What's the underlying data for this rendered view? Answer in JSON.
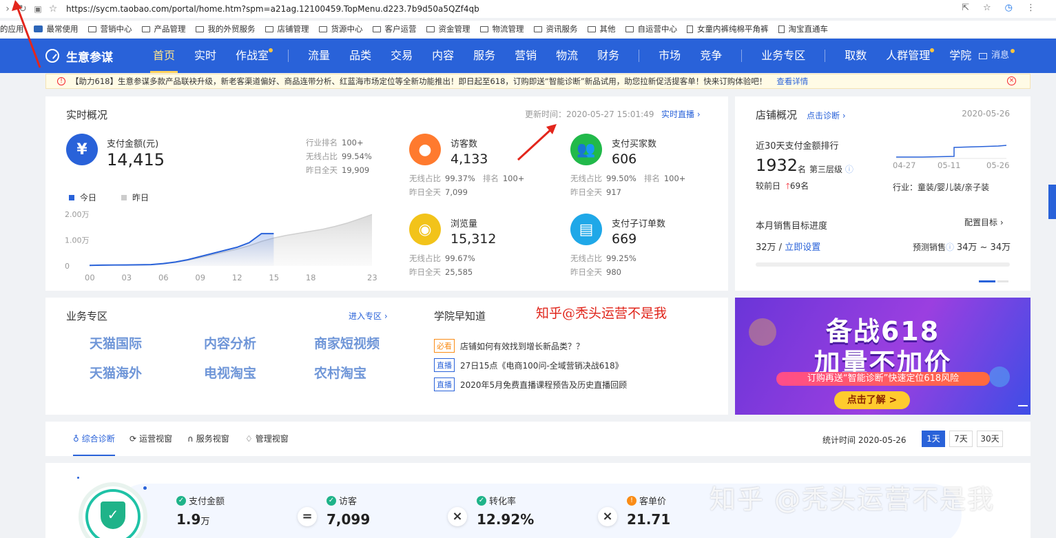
{
  "browser": {
    "url": "https://sycm.taobao.com/portal/home.htm?spm=a21ag.12100459.TopMenu.d223.7b9d50a5QZf4qb",
    "bookmarks": [
      "的应用",
      "最常使用",
      "营销中心",
      "产品管理",
      "我的外贸服务",
      "店铺管理",
      "货源中心",
      "客户运营",
      "资金管理",
      "物流管理",
      "资讯服务",
      "其他",
      "自运营中心",
      "女童内裤纯棉平角裤",
      "淘宝直通车"
    ]
  },
  "nav": {
    "brand": "生意参谋",
    "items": [
      "首页",
      "实时",
      "作战室",
      "流量",
      "品类",
      "交易",
      "内容",
      "服务",
      "营销",
      "物流",
      "财务",
      "市场",
      "竞争",
      "业务专区",
      "取数",
      "人群管理",
      "学院"
    ],
    "message": "消息"
  },
  "notice": {
    "text": "【助力618】生意参谋多款产品联袂升级，新老客渠道偏好、商品连带分析、红蓝海市场定位等全新功能推出！即日起至618，订购即送“智能诊断”新品试用，助您拉新促活提客单！快来订购体验吧！",
    "link": "查看详情"
  },
  "realtime": {
    "title": "实时概况",
    "update_time": "更新时间：2020-05-27 15:01:49",
    "live_link": "实时直播",
    "pay_amount": {
      "label": "支付金额(元)",
      "value": "14,415",
      "rank_label": "行业排名",
      "rank": "100+",
      "wireless_label": "无线占比",
      "wireless": "99.54%",
      "yday_label": "昨日全天",
      "yday": "19,909"
    },
    "visitors": {
      "label": "访客数",
      "value": "4,133",
      "wireless_label": "无线占比",
      "wireless": "99.37%",
      "rank_label": "排名",
      "rank": "100+",
      "yday_label": "昨日全天",
      "yday": "7,099"
    },
    "buyers": {
      "label": "支付买家数",
      "value": "606",
      "wireless_label": "无线占比",
      "wireless": "99.50%",
      "rank_label": "排名",
      "rank": "100+",
      "yday_label": "昨日全天",
      "yday": "917"
    },
    "pageviews": {
      "label": "浏览量",
      "value": "15,312",
      "wireless_label": "无线占比",
      "wireless": "99.67%",
      "yday_label": "昨日全天",
      "yday": "25,585"
    },
    "sub_orders": {
      "label": "支付子订单数",
      "value": "669",
      "wireless_label": "无线占比",
      "wireless": "99.25%",
      "yday_label": "昨日全天",
      "yday": "980"
    },
    "legend_today": "今日",
    "legend_yday": "昨日",
    "y_labels": [
      "2.00万",
      "1.00万",
      "0"
    ],
    "x_labels": [
      "00",
      "03",
      "06",
      "09",
      "12",
      "15",
      "18",
      "23"
    ]
  },
  "chart_data": {
    "type": "area",
    "x": [
      0,
      1,
      2,
      3,
      4,
      5,
      6,
      7,
      8,
      9,
      10,
      11,
      12,
      13,
      14,
      15,
      16,
      17,
      18,
      19,
      20,
      21,
      22,
      23
    ],
    "series": [
      {
        "name": "今日",
        "values": [
          200,
          300,
          350,
          380,
          420,
          500,
          900,
          1500,
          2400,
          3600,
          4800,
          6000,
          7200,
          9000,
          12500,
          12500
        ]
      },
      {
        "name": "昨日",
        "values": [
          150,
          250,
          300,
          330,
          380,
          450,
          800,
          1400,
          2200,
          3200,
          4300,
          5400,
          6500,
          7800,
          9500,
          10800,
          11800,
          12600,
          13400,
          14200,
          15300,
          16600,
          18200,
          19909
        ]
      }
    ],
    "ylim": [
      0,
      20000
    ],
    "ytick_labels": [
      "0",
      "1.00万",
      "2.00万"
    ],
    "xtick_labels": [
      "00",
      "03",
      "06",
      "09",
      "12",
      "15",
      "18",
      "23"
    ],
    "grid": false,
    "legend": "top-left",
    "colors": {
      "today": "#2962d9",
      "yday": "#cfcfcf"
    }
  },
  "shop": {
    "title": "店铺概况",
    "diagnose_link": "点击诊断",
    "date": "2020-05-26",
    "rank_title": "近30天支付金额排行",
    "rank_value": "1932",
    "rank_unit": "名",
    "tier": "第三层级",
    "compare_label": "较前日",
    "compare_value": "69名",
    "spark_dates": [
      "04-27",
      "05-11",
      "05-26"
    ],
    "industry": "行业：童装/婴儿装/亲子装",
    "target_title": "本月销售目标进度",
    "target_config": "配置目标",
    "target_value": "32万 /",
    "target_set": "立即设置",
    "forecast_label": "预测销售",
    "forecast_value": "34万 ~ 34万"
  },
  "business": {
    "title": "业务专区",
    "enter": "进入专区",
    "items": [
      "天猫国际",
      "内容分析",
      "商家短视频",
      "天猫海外",
      "电视淘宝",
      "农村淘宝"
    ]
  },
  "academy": {
    "title": "学院早知道",
    "news": [
      {
        "tag": "必看",
        "text": "店铺如何有效找到增长新品类？？"
      },
      {
        "tag": "直播",
        "text": "27日15点《电商100问-全域营销决战618》"
      },
      {
        "tag": "直播",
        "text": "2020年5月免费直播课程预告及历史直播回顾"
      }
    ]
  },
  "annotation": "知乎@秃头运营不是我",
  "banner": {
    "line1": "备战618",
    "line2": "加量不加价",
    "line3": "订购再送“智能诊断”快速定位618风险",
    "button": "点击了解 >"
  },
  "tabs": {
    "items": [
      "综合诊断",
      "运营视窗",
      "服务视窗",
      "管理视窗"
    ],
    "stat_time": "统计时间 2020-05-26",
    "ranges": [
      "1天",
      "7天",
      "30天"
    ]
  },
  "diagnosis": {
    "pay": {
      "label": "支付金额",
      "value": "1.9",
      "unit": "万"
    },
    "visitors": {
      "label": "访客",
      "value": "7,099"
    },
    "conversion": {
      "label": "转化率",
      "value": "12.92%"
    },
    "aov": {
      "label": "客单价",
      "value": "21.71"
    },
    "ops": [
      "=",
      "×",
      "×"
    ]
  },
  "watermark": "知乎 @秃头运营不是我"
}
